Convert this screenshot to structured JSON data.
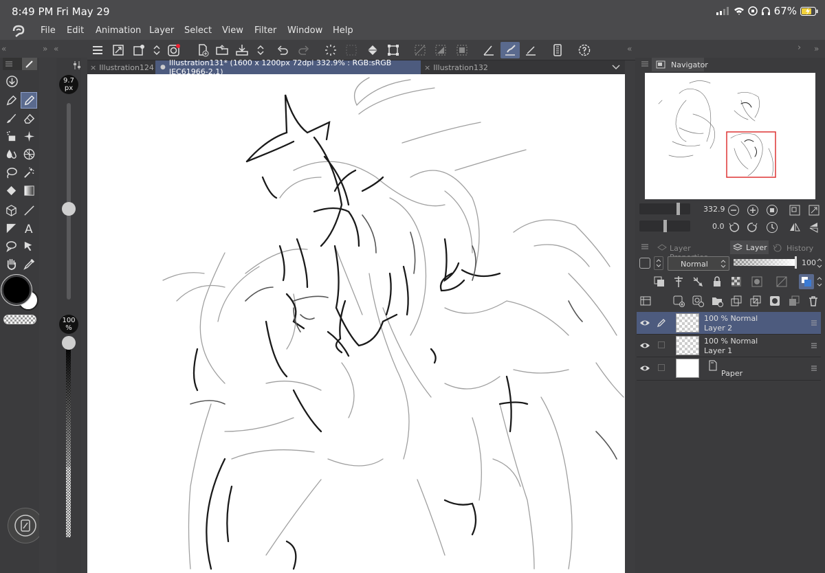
{
  "status": {
    "time": "8:49 PM",
    "date": "Fri May 29",
    "battery": "67%"
  },
  "menu": [
    "File",
    "Edit",
    "Animation",
    "Layer",
    "Select",
    "View",
    "Filter",
    "Window",
    "Help"
  ],
  "tabs": [
    {
      "label": "Illustration124",
      "active": false
    },
    {
      "label": "Illustration131* (1600 x 1200px 72dpi 332.9% : RGB:sRGB IEC61966-2.1)",
      "active": true
    },
    {
      "label": "Illustration132",
      "active": false
    }
  ],
  "brush": {
    "size": "9.7",
    "size_unit": "px",
    "opacity": "100",
    "opacity_unit": "%"
  },
  "navigator": {
    "title": "Navigator",
    "zoom": "332.9",
    "rotation": "0.0"
  },
  "panel_tabs": {
    "properties": "Layer Properties",
    "layer": "Layer",
    "history": "History"
  },
  "layer_panel": {
    "blend_mode": "Normal",
    "opacity": "100"
  },
  "layers": [
    {
      "mode": "100 %  Normal",
      "name": "Layer 2",
      "selected": true
    },
    {
      "mode": "100 %  Normal",
      "name": "Layer 1",
      "selected": false
    },
    {
      "mode": "",
      "name": "Paper",
      "selected": false
    }
  ],
  "colors": {
    "accent": "#4d5b7e",
    "main_color": "#000000",
    "sub_color": "#ffffff",
    "canvas": "#ffffff"
  }
}
